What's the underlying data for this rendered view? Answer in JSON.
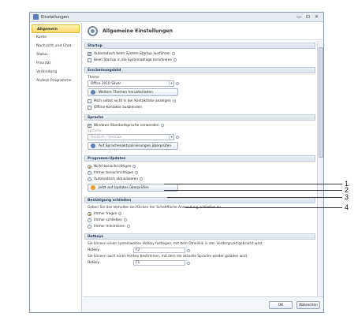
{
  "window": {
    "title": "Einstellungen",
    "controls": [
      "▭",
      "⊡",
      "✕"
    ]
  },
  "sidebar": {
    "items": [
      {
        "label": "Allgemein",
        "active": true
      },
      {
        "label": "Konto"
      },
      {
        "label": "Nachricht und Chat"
      },
      {
        "label": "Status"
      },
      {
        "label": "Priorität"
      },
      {
        "label": "Verbindung"
      },
      {
        "label": "Andere Programme"
      }
    ]
  },
  "header": {
    "title": "Allgemeine Einstellungen"
  },
  "startup": {
    "title": "Startup",
    "auto_start": "Automatisch beim System-Startup ausführen",
    "minimize": "Beim Startup in die Systemablage minimieren"
  },
  "appearance": {
    "title": "Erscheinungsbild",
    "theme_label": "Theme",
    "theme_value": "Office 2010 Silver",
    "download_btn": "Weitere Themen herunterladen",
    "show_self": "Mich selbst nicht in der Kontaktliste anzeigen",
    "hide_offline": "Offline-Kontakte ausblenden"
  },
  "language": {
    "title": "Sprache",
    "use_windows": "Windows-Standardsprache verwenden",
    "lang_label": "Sprache",
    "lang_value": "Deutsch - German",
    "check_btn": "Auf Sprachenaktualisierungen überprüfen"
  },
  "updates": {
    "title": "Programm-Updates",
    "opt1": "Nicht benachrichtigen",
    "opt2": "Immer benachrichtigen",
    "opt3": "Automatisch aktualisieren",
    "check_btn": "Jetzt auf Updates überprüfen"
  },
  "close_confirm": {
    "title": "Bestätigung schließen",
    "desc": "Geben Sie das Verhalten bei Klicken der Schaltfläche Anwendung schließen an.",
    "opt1": "Immer fragen",
    "opt2": "Immer schließen",
    "opt3": "Immer minimieren"
  },
  "hotkeys": {
    "title": "Hotkeys",
    "desc1": "Sie können einen systemweiten Hotkey festlegen, mit dem Omnilink in den Vordergrund gebracht wird.",
    "hotkey1_label": "Hotkey",
    "hotkey1_value": "F2",
    "desc2": "Sie können auch einen Hotkey bestimmen, mit dem die aktuelle Sprache wieder geladen wird.",
    "hotkey2_label": "Hotkey",
    "hotkey2_value": "F1"
  },
  "footer": {
    "ok": "OK",
    "cancel": "Abbrechen"
  },
  "callouts": [
    "1",
    "2",
    "3",
    "4"
  ],
  "colors": {
    "accent": "#ffd96b",
    "section_header": "#dbe2ec",
    "highlight": "#e7a020"
  }
}
